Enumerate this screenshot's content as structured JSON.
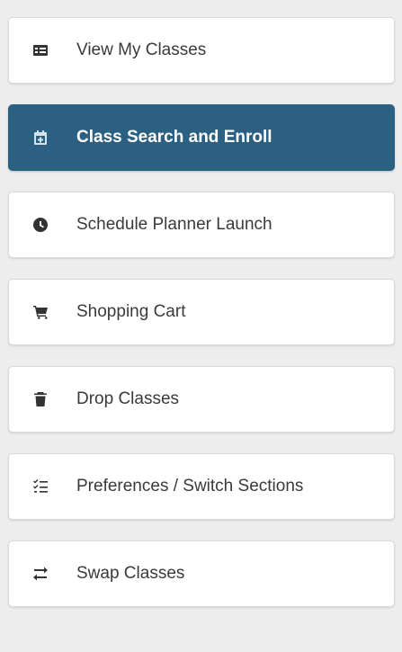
{
  "nav": {
    "items": [
      {
        "label": "View My Classes",
        "icon": "list-icon",
        "active": false
      },
      {
        "label": "Class Search and Enroll",
        "icon": "calendar-add-icon",
        "active": true
      },
      {
        "label": "Schedule Planner Launch",
        "icon": "clock-icon",
        "active": false
      },
      {
        "label": "Shopping Cart",
        "icon": "cart-icon",
        "active": false
      },
      {
        "label": "Drop Classes",
        "icon": "trash-icon",
        "active": false
      },
      {
        "label": "Preferences / Switch Sections",
        "icon": "checklist-icon",
        "active": false
      },
      {
        "label": "Swap Classes",
        "icon": "swap-arrows-icon",
        "active": false
      }
    ]
  },
  "colors": {
    "background": "#ededed",
    "card": "#ffffff",
    "active": "#2c6082",
    "text": "#3a3a3a",
    "icon": "#333333"
  }
}
